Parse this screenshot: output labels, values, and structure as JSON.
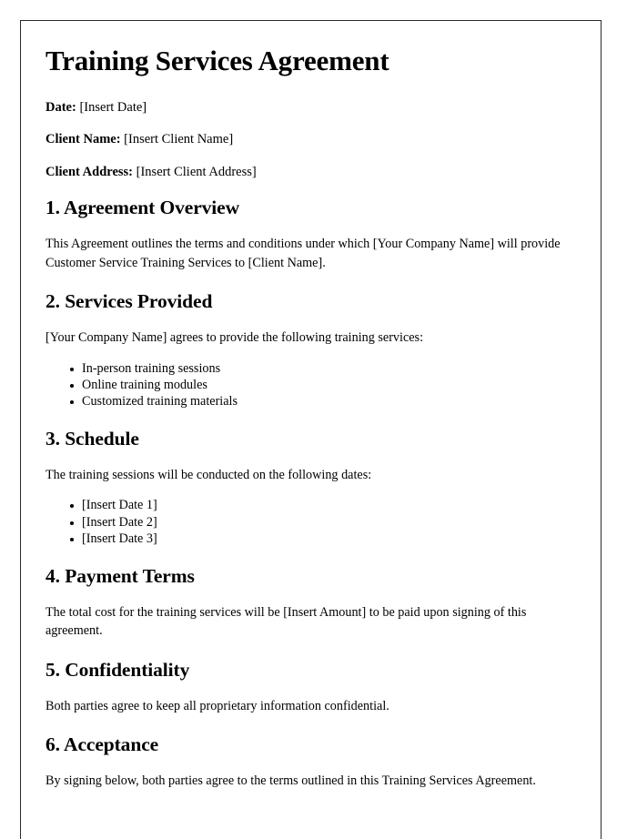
{
  "document": {
    "title": "Training Services Agreement",
    "meta": [
      {
        "label": "Date:",
        "value": "[Insert Date]"
      },
      {
        "label": "Client Name:",
        "value": "[Insert Client Name]"
      },
      {
        "label": "Client Address:",
        "value": "[Insert Client Address]"
      }
    ],
    "sections": [
      {
        "heading": "1. Agreement Overview",
        "paragraph": "This Agreement outlines the terms and conditions under which [Your Company Name] will provide Customer Service Training Services to [Client Name]."
      },
      {
        "heading": "2. Services Provided",
        "paragraph": "[Your Company Name] agrees to provide the following training services:",
        "items": [
          "In-person training sessions",
          "Online training modules",
          "Customized training materials"
        ]
      },
      {
        "heading": "3. Schedule",
        "paragraph": "The training sessions will be conducted on the following dates:",
        "items": [
          "[Insert Date 1]",
          "[Insert Date 2]",
          "[Insert Date 3]"
        ]
      },
      {
        "heading": "4. Payment Terms",
        "paragraph": "The total cost for the training services will be [Insert Amount] to be paid upon signing of this agreement."
      },
      {
        "heading": "5. Confidentiality",
        "paragraph": "Both parties agree to keep all proprietary information confidential."
      },
      {
        "heading": "6. Acceptance",
        "paragraph": "By signing below, both parties agree to the terms outlined in this Training Services Agreement."
      }
    ]
  }
}
